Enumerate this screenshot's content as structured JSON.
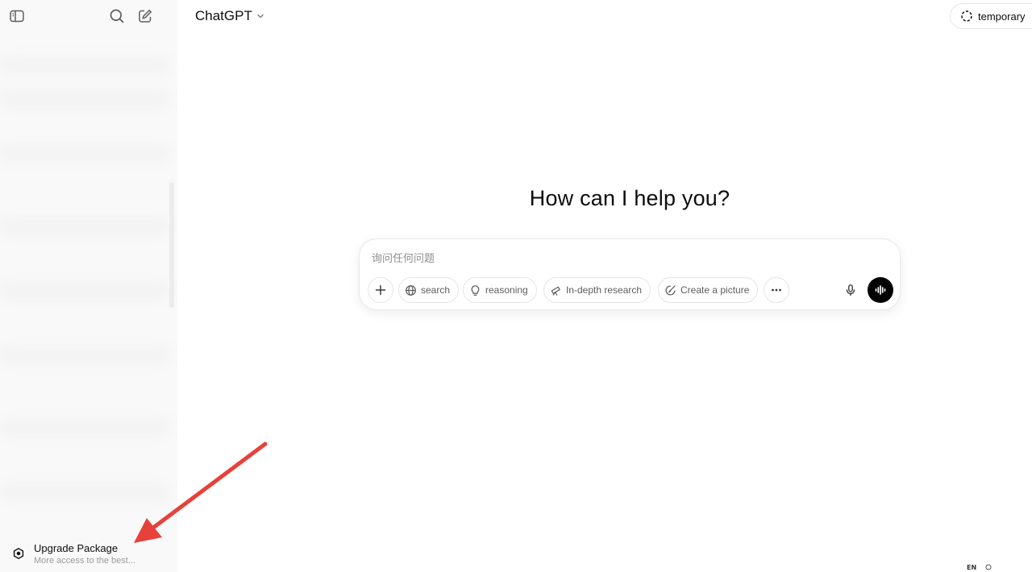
{
  "header": {
    "model_label": "ChatGPT",
    "temporary_label": "temporary"
  },
  "main": {
    "hero_title": "How can I help you?"
  },
  "composer": {
    "placeholder": "询问任何问题",
    "tools": {
      "search": "search",
      "reasoning": "reasoning",
      "research": "In-depth research",
      "picture": "Create a picture"
    }
  },
  "sidebar": {
    "upgrade_title": "Upgrade Package",
    "upgrade_subtitle": "More access to the best..."
  },
  "system_tray": {
    "ime_label": "EN"
  },
  "colors": {
    "sidebar_bg": "#f9f9f9",
    "annotation_arrow": "#e8413a",
    "voice_button": "#000000"
  }
}
